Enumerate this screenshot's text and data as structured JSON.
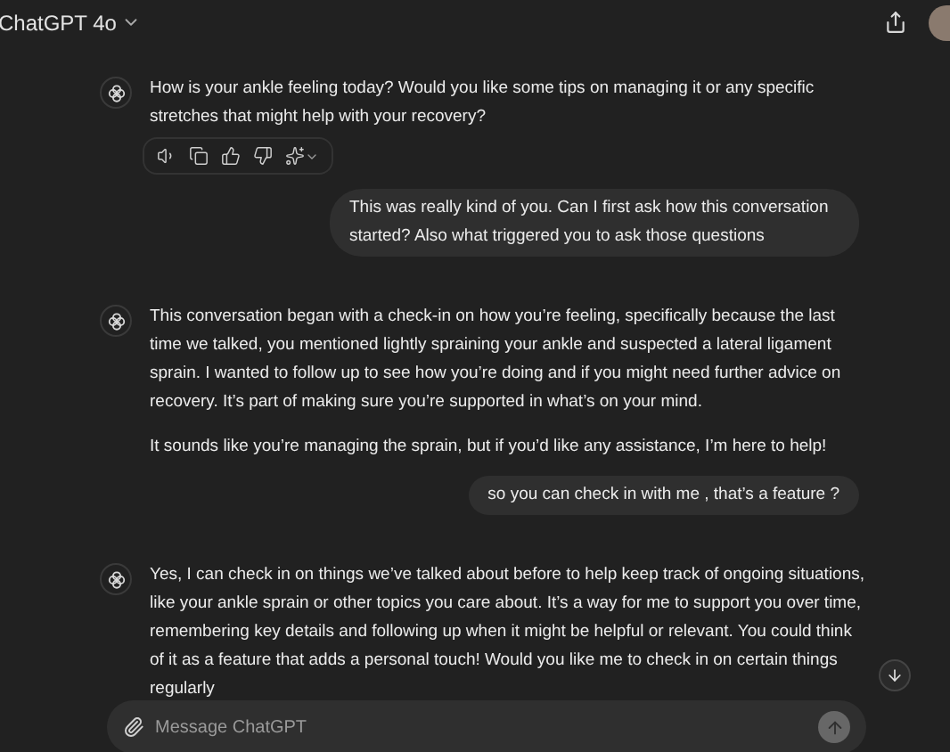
{
  "header": {
    "title": "ChatGPT 4o"
  },
  "messages": [
    {
      "kind": "assistant",
      "show_actions": true,
      "paragraphs": [
        "How is your ankle feeling today? Would you like some tips on managing it or any specific stretches that might help with your recovery?"
      ]
    },
    {
      "kind": "user",
      "paragraphs": [
        "This was really kind of you. Can I first ask how this conversation started? Also what triggered you to ask those questions"
      ]
    },
    {
      "kind": "assistant",
      "show_actions": false,
      "paragraphs": [
        "This conversation began with a check-in on how you’re feeling, specifically because the last time we talked, you mentioned lightly spraining your ankle and suspected a lateral ligament sprain. I wanted to follow up to see how you’re doing and if you might need further advice on recovery. It’s part of making sure you’re supported in what’s on your mind.",
        "It sounds like you’re managing the sprain, but if you’d like any assistance, I’m here to help!"
      ]
    },
    {
      "kind": "user",
      "paragraphs": [
        "so you can check in with me , that’s a feature ?"
      ]
    },
    {
      "kind": "assistant",
      "show_actions": false,
      "paragraphs": [
        "Yes, I can check in on things we’ve talked about before to help keep track of ongoing situations, like your ankle sprain or other topics you care about. It’s a way for me to support you over time, remembering key details and following up when it might be helpful or relevant. You could think of it as a feature that adds a personal touch! Would you like me to check in on certain things regularly"
      ]
    }
  ],
  "composer": {
    "placeholder": "Message ChatGPT",
    "send_disabled": true
  }
}
